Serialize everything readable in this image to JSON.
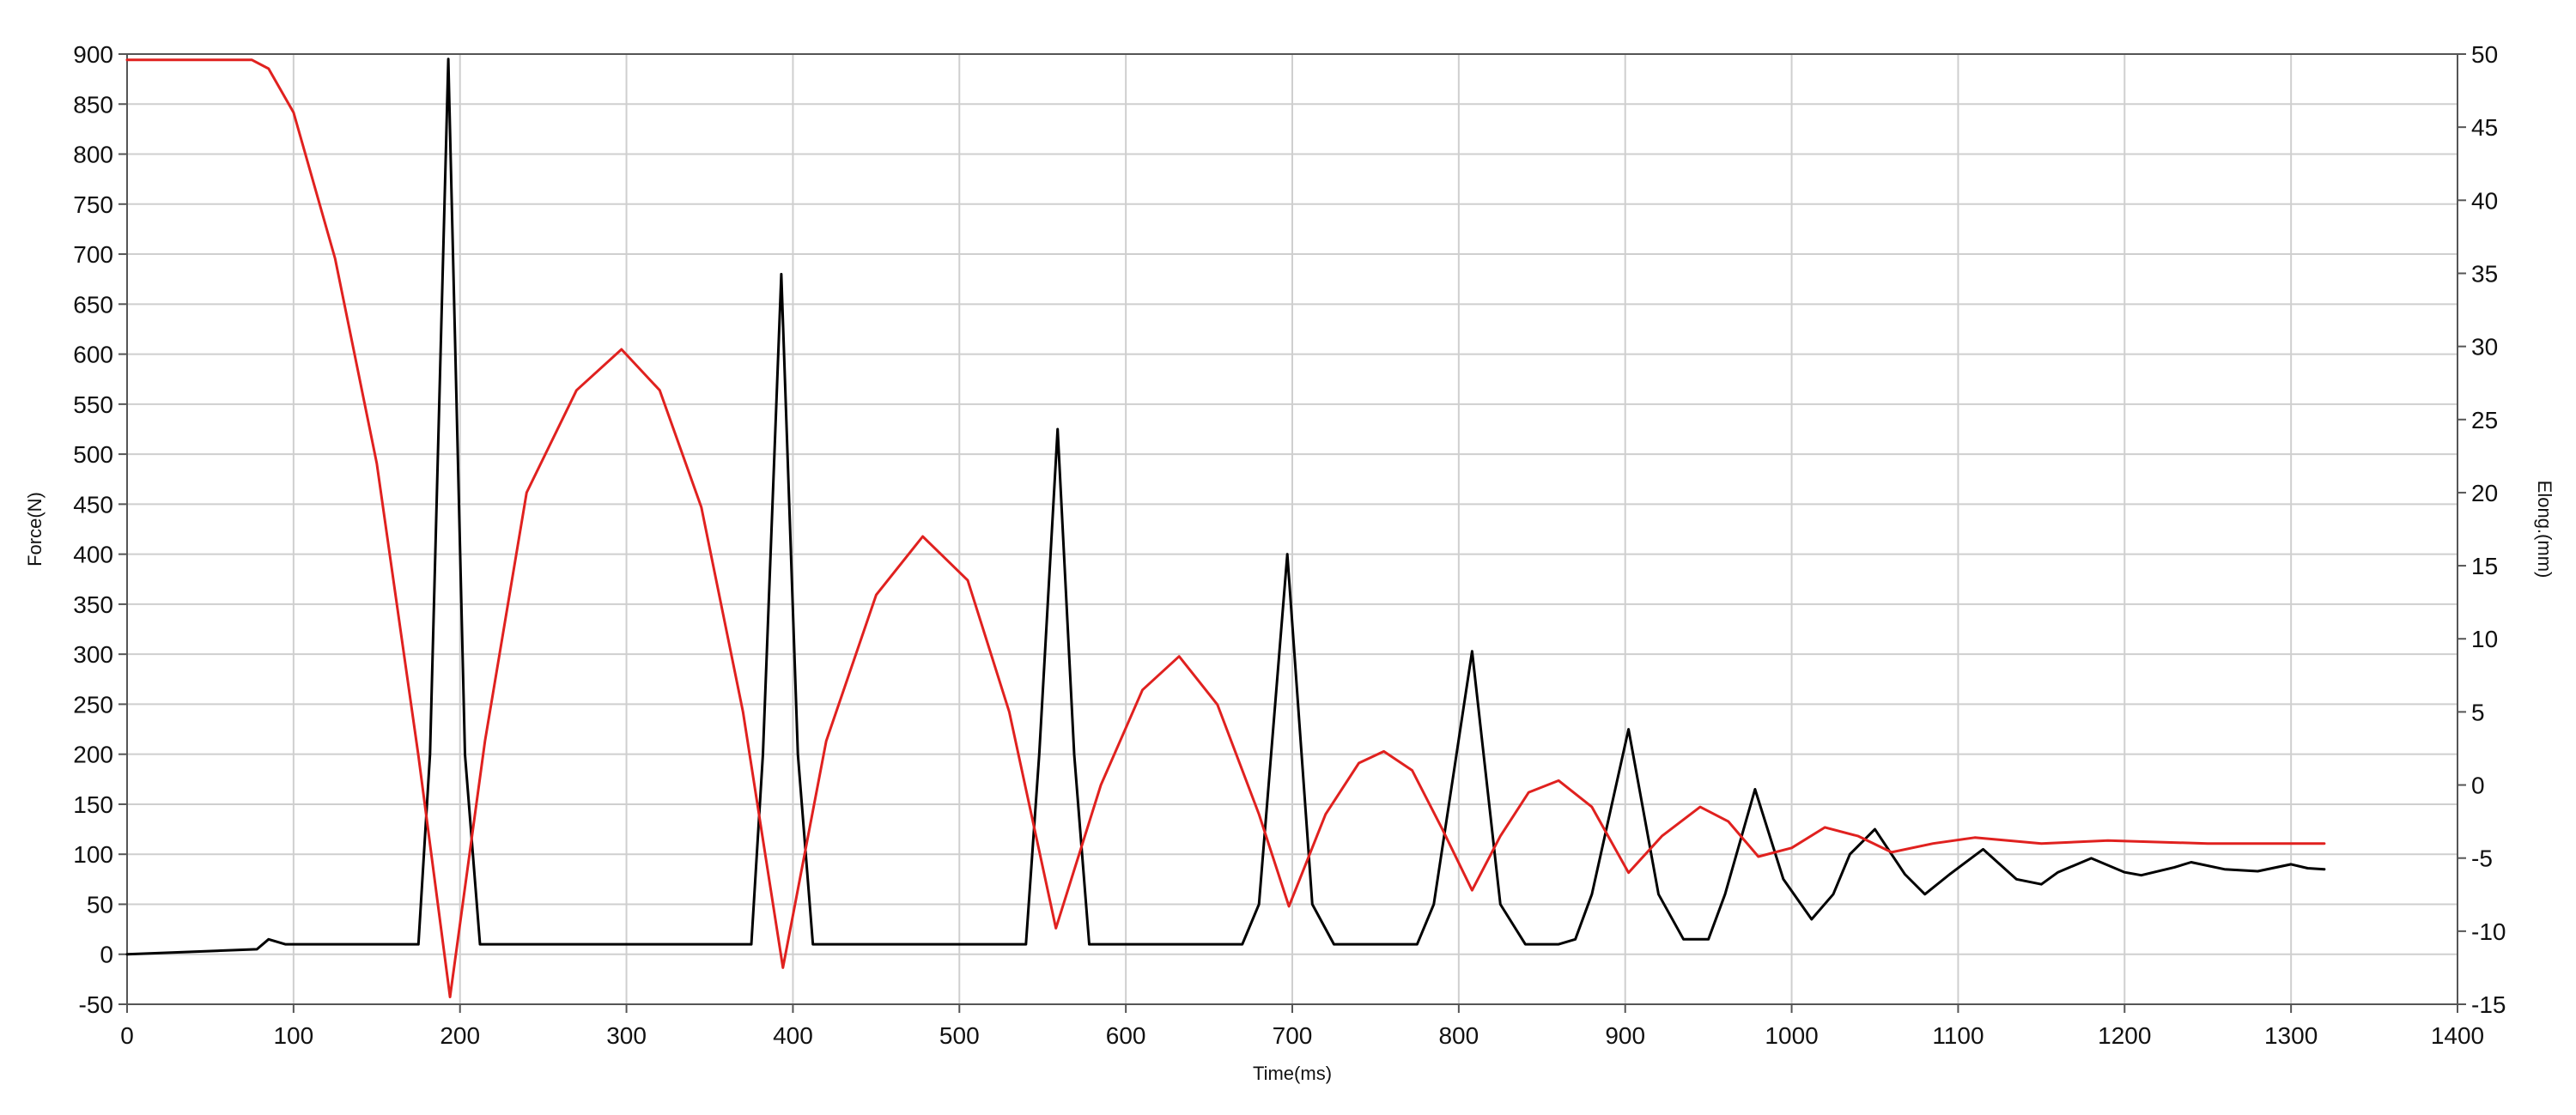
{
  "chart_data": {
    "type": "line",
    "title": "",
    "xlabel": "Time(ms)",
    "ylabel": "Force(N)",
    "y2label": "Elong.(mm)",
    "xlim": [
      0,
      1400
    ],
    "ylim": [
      -50,
      900
    ],
    "y2lim": [
      -15,
      50
    ],
    "x_ticks": [
      "0",
      "100",
      "200",
      "300",
      "400",
      "500",
      "600",
      "700",
      "800",
      "900",
      "1000",
      "1100",
      "1200",
      "1300",
      "1400"
    ],
    "y_ticks": [
      "-50",
      "0",
      "50",
      "100",
      "150",
      "200",
      "250",
      "300",
      "350",
      "400",
      "450",
      "500",
      "550",
      "600",
      "650",
      "700",
      "750",
      "800",
      "850",
      "900"
    ],
    "y2_ticks": [
      "-15",
      "-10",
      "-5",
      "0",
      "5",
      "10",
      "15",
      "20",
      "25",
      "30",
      "35",
      "40",
      "45",
      "50"
    ],
    "grid": true,
    "legend": "none",
    "colors": {
      "force": "#000000",
      "elongation": "#e0211f",
      "grid": "#cfcfcf"
    },
    "series": [
      {
        "key": "force",
        "axis": "left",
        "color": "#000000",
        "x": [
          0,
          78,
          85,
          95,
          175,
          182,
          193,
          203,
          212,
          220,
          375,
          382,
          393,
          403,
          412,
          420,
          540,
          548,
          559,
          569,
          578,
          586,
          670,
          680,
          697,
          712,
          725,
          735,
          775,
          785,
          808,
          825,
          840,
          860,
          870,
          880,
          902,
          920,
          935,
          950,
          960,
          978,
          995,
          1012,
          1025,
          1035,
          1050,
          1068,
          1080,
          1095,
          1115,
          1135,
          1150,
          1160,
          1180,
          1200,
          1210,
          1230,
          1240,
          1260,
          1280,
          1300,
          1310,
          1320
        ],
        "y": [
          0,
          5,
          15,
          10,
          10,
          200,
          895,
          200,
          10,
          10,
          10,
          200,
          680,
          200,
          10,
          10,
          10,
          200,
          525,
          200,
          10,
          10,
          10,
          50,
          400,
          50,
          10,
          10,
          10,
          50,
          303,
          50,
          10,
          10,
          15,
          60,
          225,
          60,
          15,
          15,
          60,
          165,
          75,
          35,
          60,
          100,
          125,
          80,
          60,
          80,
          105,
          75,
          70,
          82,
          96,
          82,
          79,
          87,
          92,
          85,
          83,
          90,
          86,
          85
        ]
      },
      {
        "key": "elongation",
        "axis": "right",
        "color": "#e0211f",
        "x": [
          0,
          75,
          85,
          100,
          125,
          150,
          175,
          194,
          215,
          240,
          270,
          297,
          320,
          345,
          370,
          394,
          420,
          450,
          478,
          505,
          530,
          558,
          585,
          610,
          632,
          655,
          680,
          698,
          720,
          740,
          755,
          772,
          790,
          808,
          825,
          842,
          860,
          880,
          902,
          922,
          945,
          962,
          980,
          1000,
          1020,
          1040,
          1060,
          1085,
          1110,
          1150,
          1190,
          1250,
          1320
        ],
        "y": [
          49.6,
          49.6,
          49,
          46,
          36,
          22,
          2,
          -14.5,
          3,
          20,
          27,
          29.8,
          27,
          19,
          5,
          -12.5,
          3,
          13,
          17,
          14,
          5,
          -9.8,
          0,
          6.5,
          8.8,
          5.5,
          -2,
          -8.3,
          -2,
          1.5,
          2.3,
          1,
          -3,
          -7.2,
          -3.5,
          -0.5,
          0.3,
          -1.5,
          -6,
          -3.5,
          -1.5,
          -2.5,
          -4.9,
          -4.3,
          -2.9,
          -3.5,
          -4.6,
          -4,
          -3.6,
          -4,
          -3.8,
          -4,
          -4
        ]
      }
    ]
  }
}
